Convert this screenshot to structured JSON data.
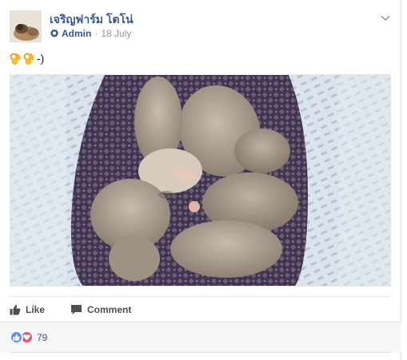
{
  "post": {
    "page_name": "เจริญฟาร์ม โตโน่",
    "role": "Admin",
    "separator": "·",
    "date": "18 July",
    "text_suffix": "-)"
  },
  "actions": {
    "like_label": "Like",
    "comment_label": "Comment"
  },
  "reactions": {
    "count": "79",
    "types": [
      "like",
      "love"
    ]
  },
  "icons": {
    "badge": "admin-badge-icon",
    "menu": "chevron-down-icon",
    "emoji": "ok-hand-emoji-icon",
    "like": "thumbs-up-icon",
    "comment": "comment-icon"
  },
  "colors": {
    "link": "#365899",
    "muted": "#90949c",
    "action_text": "#4b4f56",
    "like_reaction": "#5890ff",
    "love_reaction": "#f25268"
  }
}
